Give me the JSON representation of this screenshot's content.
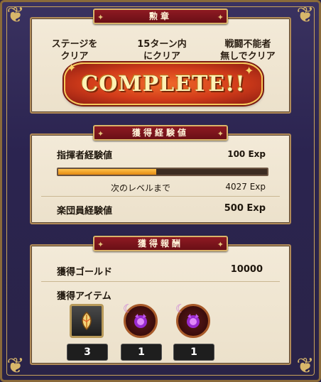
{
  "badges": {
    "title": "勲章",
    "items": [
      {
        "line1": "ステージを",
        "line2": "クリア"
      },
      {
        "line1": "15ターン内",
        "line2": "にクリア"
      },
      {
        "line1": "戦闘不能者",
        "line2": "無しでクリア"
      }
    ],
    "complete_text": "COMPLETE!!"
  },
  "exp": {
    "title": "獲得経験値",
    "conductor_label": "指揮者経験値",
    "conductor_value": "100 Exp",
    "progress": 0.47,
    "next_level_label": "次のレベルまで",
    "next_level_value": "4027 Exp",
    "band_label": "楽団員経験値",
    "band_value": "500 Exp"
  },
  "rewards": {
    "title": "獲得報酬",
    "gold_label": "獲得ゴールド",
    "gold_value": "10000",
    "items_label": "獲得アイテム",
    "items": [
      {
        "icon": "feather-crystal-icon",
        "count": "3"
      },
      {
        "icon": "purple-demon-orb-icon",
        "count": "1"
      },
      {
        "icon": "purple-demon-orb-icon",
        "count": "1"
      }
    ]
  },
  "colors": {
    "ribbon": "#8e1a22",
    "panel": "#f3ead8",
    "bar_fill": "#f0a020",
    "background": "#2a2347"
  }
}
